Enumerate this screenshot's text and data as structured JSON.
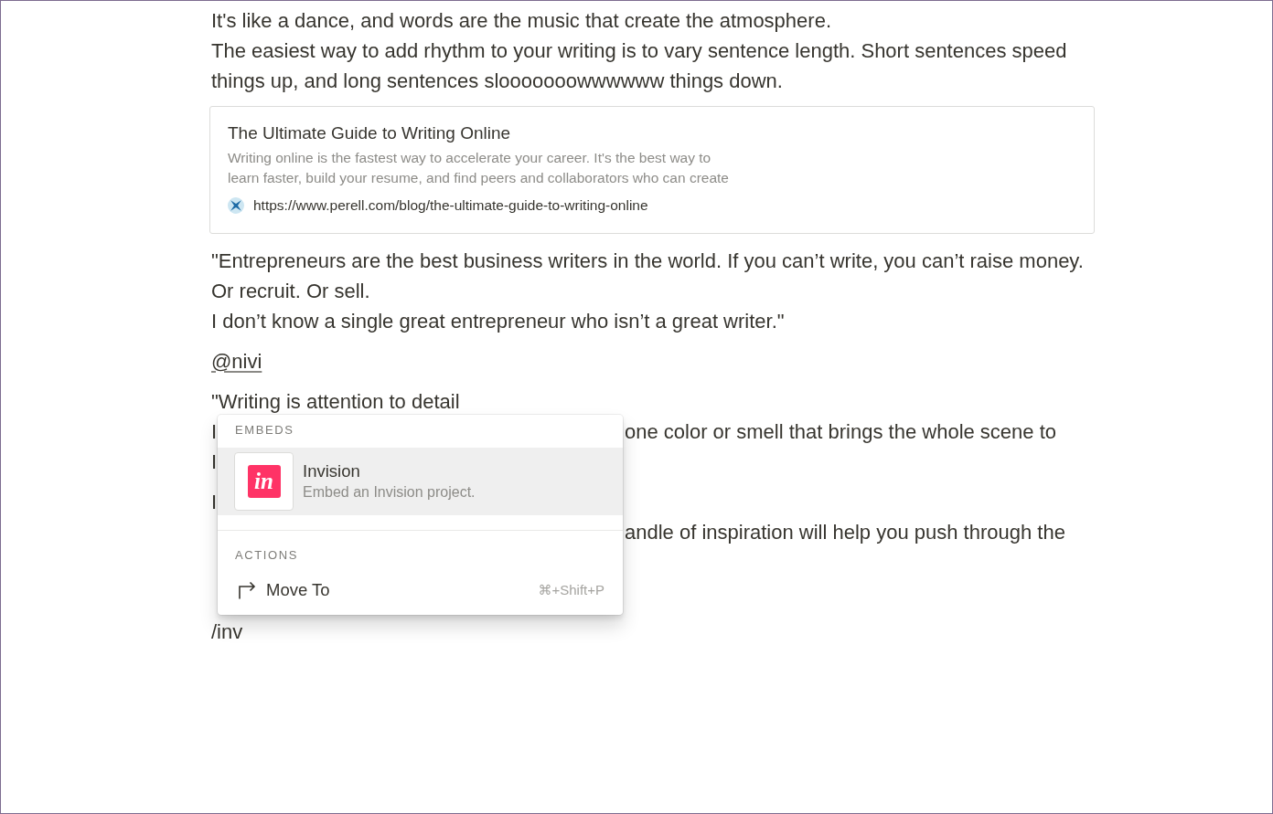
{
  "document": {
    "blocks": [
      {
        "kind": "text",
        "text": "It's like a dance, and words are the music that create the atmosphere.\nThe easiest way to add rhythm to your writing is to vary sentence length. Short sentences speed\nthings up, and long sentences slooooooowwwwww things down."
      },
      {
        "kind": "bookmark",
        "title": "The Ultimate Guide to Writing Online",
        "description": "Writing online is the fastest way to accelerate your career. It's the best way to\nlearn faster, build your resume, and find peers and collaborators who can create",
        "url": "https://www.perell.com/blog/the-ultimate-guide-to-writing-online"
      },
      {
        "kind": "text",
        "text": "\"Entrepreneurs are the best business writers in the world. If you can’t write, you can’t raise money.\nOr recruit. Or sell.\nI don’t know a single great entrepreneur who isn’t a great writer.\""
      },
      {
        "kind": "mention",
        "text": "@nivi"
      },
      {
        "kind": "covered",
        "lines": [
          {
            "left": "\"Writing is attention to detail"
          },
          {
            "left": "I",
            "right": "one color or smell that brings the whole scene to"
          },
          {
            "left": "I"
          }
        ]
      },
      {
        "kind": "covered",
        "lines": [
          {
            "left": "I"
          },
          {
            "right": "andle of inspiration will help you push through the"
          }
        ]
      },
      {
        "kind": "text",
        "text": "/inv"
      }
    ]
  },
  "slash_menu": {
    "sections": [
      {
        "heading": "EMBEDS",
        "items": [
          {
            "kind": "embed",
            "logo_text": "in",
            "title": "Invision",
            "description": "Embed an Invision project.",
            "selected": true
          }
        ]
      },
      {
        "heading": "ACTIONS",
        "items": [
          {
            "kind": "action",
            "title": "Move To",
            "shortcut": "⌘+Shift+P",
            "selected": false
          }
        ]
      }
    ]
  }
}
